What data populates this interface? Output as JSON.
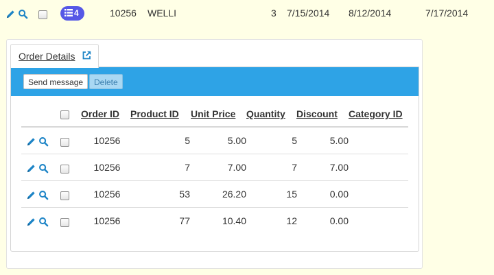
{
  "master_row": {
    "badge_count": "4",
    "order_id": "10256",
    "customer_id": "WELLI",
    "ship_via": "3",
    "order_date": "7/15/2014",
    "required_date": "8/12/2014",
    "shipped_date": "7/17/2014"
  },
  "detail": {
    "tab_label": "Order Details",
    "toolbar": {
      "send_label": "Send message",
      "delete_label": "Delete"
    },
    "columns": [
      "Order ID",
      "Product ID",
      "Unit Price",
      "Quantity",
      "Discount",
      "Category ID"
    ],
    "rows": [
      {
        "order_id": "10256",
        "product_id": "5",
        "unit_price": "5.00",
        "quantity": "5",
        "discount": "5.00",
        "category_id": ""
      },
      {
        "order_id": "10256",
        "product_id": "7",
        "unit_price": "7.00",
        "quantity": "7",
        "discount": "7.00",
        "category_id": ""
      },
      {
        "order_id": "10256",
        "product_id": "53",
        "unit_price": "26.20",
        "quantity": "15",
        "discount": "0.00",
        "category_id": ""
      },
      {
        "order_id": "10256",
        "product_id": "77",
        "unit_price": "10.40",
        "quantity": "12",
        "discount": "0.00",
        "category_id": ""
      }
    ]
  },
  "colors": {
    "accent": "#2ea3e6",
    "badge": "#5658e6",
    "icon": "#1d84c6",
    "background": "#ffffe6"
  }
}
